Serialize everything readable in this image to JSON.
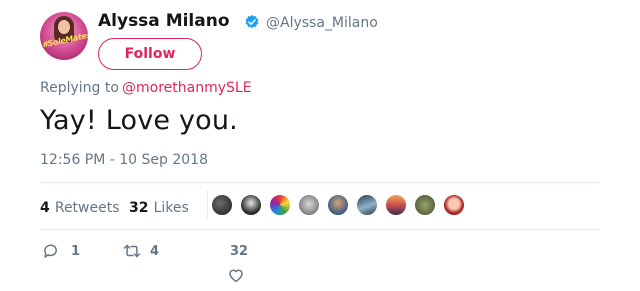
{
  "author": {
    "display_name": "Alyssa Milano",
    "handle": "@Alyssa_Milano",
    "avatar_text": "#SoleMates",
    "verified": true
  },
  "follow_button": {
    "label": "Follow"
  },
  "reply": {
    "prefix": "Replying to",
    "mention": "@morethanmySLE"
  },
  "tweet": {
    "text": "Yay! Love you.",
    "timestamp": "12:56 PM - 10 Sep 2018"
  },
  "stats": {
    "retweets_count": "4",
    "retweets_label": "Retweets",
    "likes_count": "32",
    "likes_label": "Likes"
  },
  "likers": [
    "liker-avatar",
    "liker-avatar",
    "liker-avatar",
    "liker-avatar",
    "liker-avatar",
    "liker-avatar",
    "liker-avatar",
    "liker-avatar",
    "liker-avatar"
  ],
  "actions": {
    "reply_count": "1",
    "retweet_count": "4",
    "like_count": "32"
  },
  "colors": {
    "accent": "#e0245e",
    "secondary_text": "#657786",
    "verified": "#1da1f2",
    "divider": "#e6ecf0"
  }
}
